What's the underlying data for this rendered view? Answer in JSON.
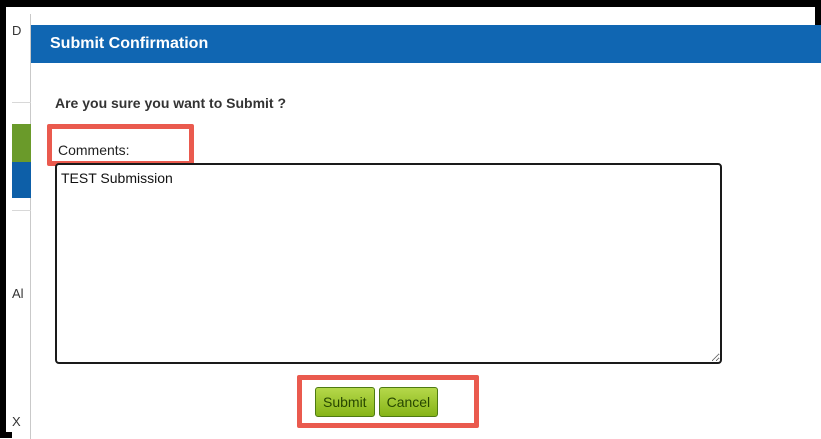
{
  "dialog": {
    "title": "Submit Confirmation",
    "question": "Are you sure you want to Submit ?",
    "comments_label": "Comments:",
    "comments_value": "TEST Submission",
    "submit_label": "Submit",
    "cancel_label": "Cancel"
  },
  "background": {
    "fragment_top": "D",
    "fragment_mid": "Al",
    "fragment_bottom": "X"
  },
  "colors": {
    "titlebar": "#1066b2",
    "button_green": "#9ac42c",
    "highlight": "#ea5a4e"
  }
}
